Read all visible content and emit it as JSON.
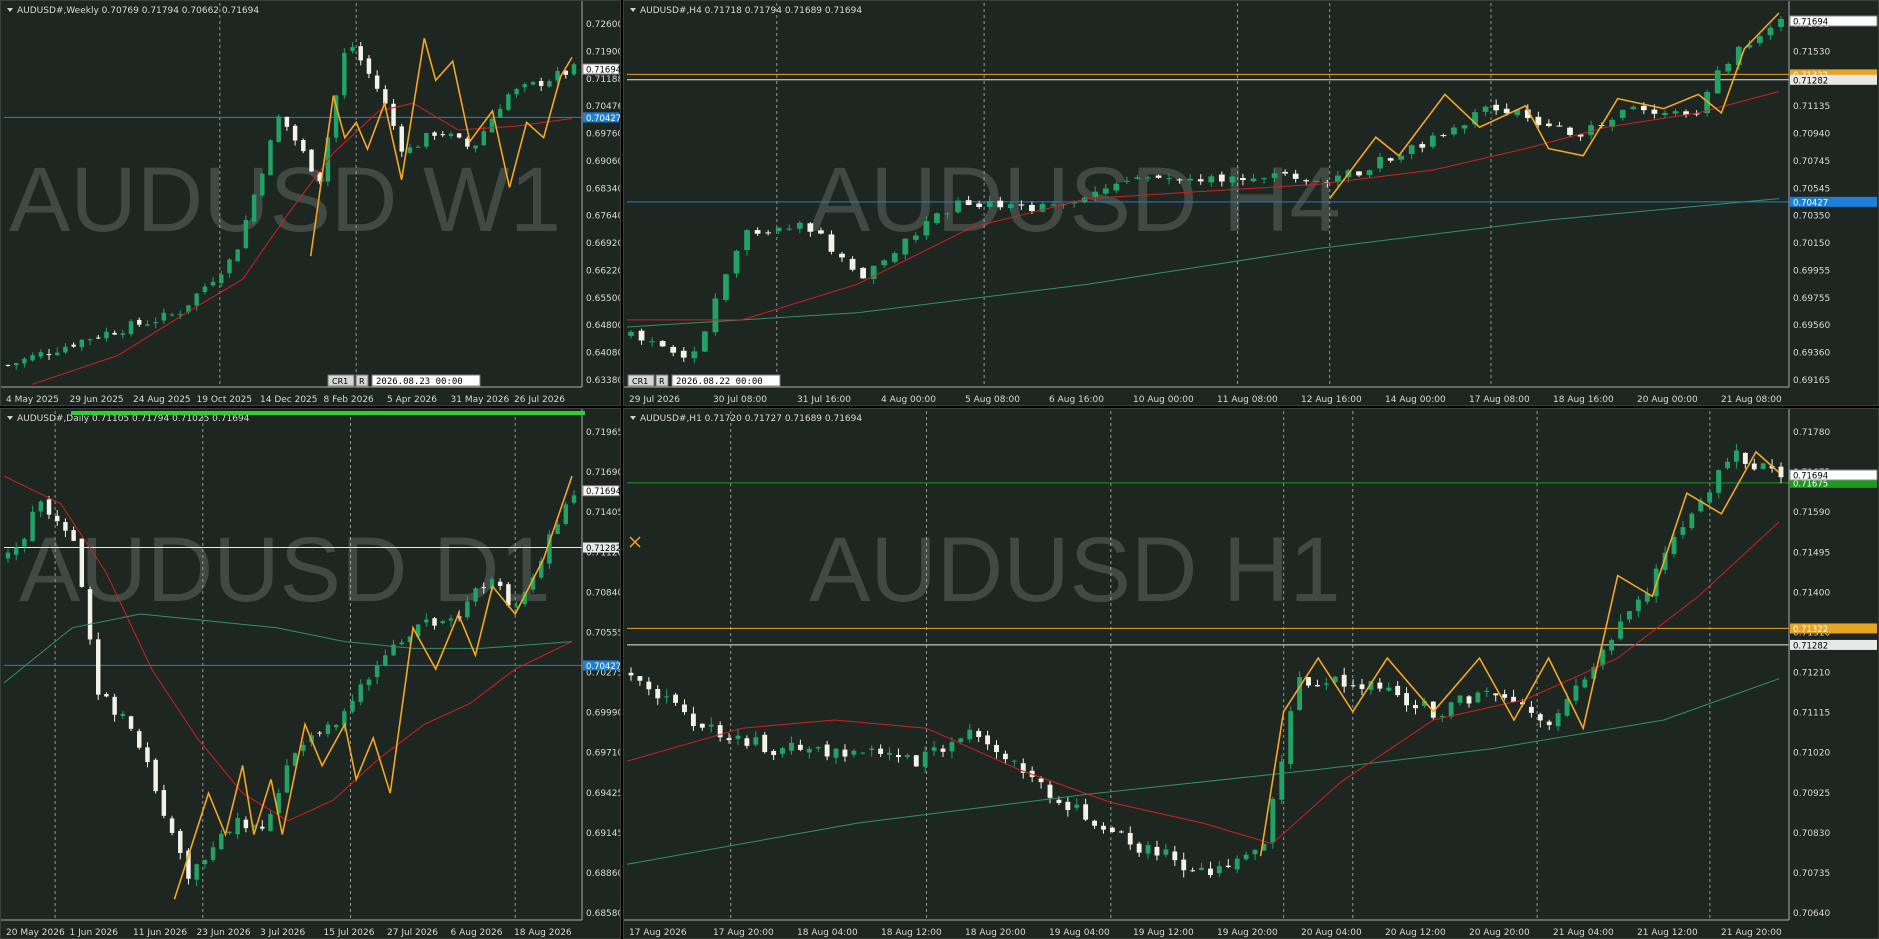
{
  "colors": {
    "bg": "#1e2621",
    "bull": "#21a366",
    "bear": "#f3f3e8",
    "ma_fast": "#d11f1f",
    "ma_slow": "#33906a",
    "zigzag": "#f5a623",
    "hline_blue": "#1c7fd8",
    "hline_white": "#e8e8e8",
    "hline_orange": "#e8a423",
    "hline_green": "#1a9b1a",
    "grid": "#c8c8c8",
    "text": "#d9d9d9"
  },
  "charts": [
    {
      "id": "w1",
      "header": "AUDUSD#,Weekly  0.70769 0.71794 0.70662 0.71694",
      "watermark": "AUDUSD W1",
      "ylim": [
        0.6338,
        0.7316
      ],
      "price_labels": [
        "0.72600",
        "0.71900",
        "0.71188",
        "0.70476",
        "0.69760",
        "0.69060",
        "0.68340",
        "0.67640",
        "0.66920",
        "0.66220",
        "0.65500",
        "0.64800",
        "0.64080",
        "0.63380"
      ],
      "time_labels": [
        "4 May 2025",
        "29 Jun 2025",
        "24 Aug 2025",
        "19 Oct 2025",
        "14 Dec 2025",
        "8 Feb 2026",
        "5 Apr 2026",
        "31 May 2026",
        "26 Jul 2026"
      ],
      "vlines": [
        0.38,
        0.62
      ],
      "hlines": [
        {
          "price": 0.7043,
          "color": "blue",
          "tag": "0.70427"
        }
      ],
      "current_price": "0.71694",
      "cursor": {
        "btn1": "CR1",
        "btn2": "R",
        "time": "2026.08.23 00:00"
      },
      "candles": {
        "count": 70,
        "start": 0.6395,
        "end": 0.7169,
        "path": [
          [
            0,
            0.6395
          ],
          [
            0.15,
            0.647
          ],
          [
            0.3,
            0.653
          ],
          [
            0.4,
            0.668
          ],
          [
            0.48,
            0.705
          ],
          [
            0.55,
            0.688
          ],
          [
            0.6,
            0.725
          ],
          [
            0.66,
            0.71
          ],
          [
            0.7,
            0.695
          ],
          [
            0.76,
            0.701
          ],
          [
            0.82,
            0.696
          ],
          [
            0.88,
            0.71
          ],
          [
            1.0,
            0.7169
          ]
        ]
      },
      "ma_fast": [
        [
          0.05,
          0.6345
        ],
        [
          0.2,
          0.642
        ],
        [
          0.33,
          0.654
        ],
        [
          0.42,
          0.662
        ],
        [
          0.5,
          0.679
        ],
        [
          0.58,
          0.695
        ],
        [
          0.66,
          0.706
        ],
        [
          0.72,
          0.708
        ],
        [
          0.8,
          0.701
        ],
        [
          0.9,
          0.702
        ],
        [
          1.0,
          0.704
        ]
      ],
      "ma_slow": [],
      "zigzag": [
        [
          0.54,
          0.668
        ],
        [
          0.58,
          0.71
        ],
        [
          0.6,
          0.699
        ],
        [
          0.62,
          0.703
        ],
        [
          0.64,
          0.696
        ],
        [
          0.67,
          0.708
        ],
        [
          0.7,
          0.688
        ],
        [
          0.74,
          0.725
        ],
        [
          0.76,
          0.714
        ],
        [
          0.79,
          0.719
        ],
        [
          0.82,
          0.698
        ],
        [
          0.86,
          0.706
        ],
        [
          0.89,
          0.686
        ],
        [
          0.92,
          0.703
        ],
        [
          0.95,
          0.699
        ],
        [
          0.98,
          0.715
        ],
        [
          1.0,
          0.72
        ]
      ]
    },
    {
      "id": "h4",
      "header": "AUDUSD#,H4  0.71718 0.71794 0.71689 0.71694",
      "watermark": "AUDUSD H4",
      "ylim": [
        0.6913,
        0.7175
      ],
      "price_labels": [
        "0.71735",
        "0.71530",
        "0.71330",
        "0.71135",
        "0.70940",
        "0.70745",
        "0.70545",
        "0.70350",
        "0.70150",
        "0.69955",
        "0.69755",
        "0.69560",
        "0.69360",
        "0.69165"
      ],
      "time_labels": [
        "29 Jul 2026",
        "30 Jul 08:00",
        "31 Jul 16:00",
        "4 Aug 00:00",
        "5 Aug 08:00",
        "6 Aug 16:00",
        "10 Aug 00:00",
        "11 Aug 08:00",
        "12 Aug 16:00",
        "14 Aug 00:00",
        "17 Aug 08:00",
        "18 Aug 16:00",
        "20 Aug 00:00",
        "21 Aug 08:00"
      ],
      "vlines": [
        0.13,
        0.31,
        0.53,
        0.61,
        0.75
      ],
      "hlines": [
        {
          "price": 0.7132,
          "color": "orange",
          "tag": "0.71322"
        },
        {
          "price": 0.71282,
          "color": "white",
          "tag": "0.71282"
        },
        {
          "price": 0.70427,
          "color": "blue",
          "tag": "0.70427"
        }
      ],
      "current_price": "0.71694",
      "cursor": {
        "btn1": "CR1",
        "btn2": "R",
        "time": "2026.08.22 00:00"
      },
      "candles": {
        "count": 110,
        "start": 0.695,
        "end": 0.7169,
        "path": [
          [
            0,
            0.695
          ],
          [
            0.05,
            0.693
          ],
          [
            0.1,
            0.702
          ],
          [
            0.15,
            0.703
          ],
          [
            0.2,
            0.699
          ],
          [
            0.28,
            0.704
          ],
          [
            0.36,
            0.704
          ],
          [
            0.45,
            0.706
          ],
          [
            0.55,
            0.706
          ],
          [
            0.62,
            0.706
          ],
          [
            0.68,
            0.708
          ],
          [
            0.75,
            0.711
          ],
          [
            0.82,
            0.709
          ],
          [
            0.88,
            0.711
          ],
          [
            0.92,
            0.71
          ],
          [
            0.96,
            0.715
          ],
          [
            1.0,
            0.7169
          ]
        ]
      },
      "ma_fast": [
        [
          0,
          0.696
        ],
        [
          0.1,
          0.696
        ],
        [
          0.2,
          0.6985
        ],
        [
          0.3,
          0.7025
        ],
        [
          0.4,
          0.7045
        ],
        [
          0.5,
          0.705
        ],
        [
          0.6,
          0.7055
        ],
        [
          0.7,
          0.7065
        ],
        [
          0.78,
          0.708
        ],
        [
          0.85,
          0.7095
        ],
        [
          0.93,
          0.7105
        ],
        [
          1.0,
          0.712
        ]
      ],
      "ma_slow": [
        [
          0,
          0.6955
        ],
        [
          0.2,
          0.6965
        ],
        [
          0.4,
          0.6985
        ],
        [
          0.6,
          0.701
        ],
        [
          0.8,
          0.703
        ],
        [
          1.0,
          0.7045
        ]
      ],
      "zigzag": [
        [
          0.61,
          0.7045
        ],
        [
          0.65,
          0.7088
        ],
        [
          0.67,
          0.7075
        ],
        [
          0.71,
          0.7118
        ],
        [
          0.74,
          0.7095
        ],
        [
          0.78,
          0.711
        ],
        [
          0.8,
          0.708
        ],
        [
          0.83,
          0.7075
        ],
        [
          0.86,
          0.7115
        ],
        [
          0.9,
          0.7108
        ],
        [
          0.93,
          0.7118
        ],
        [
          0.95,
          0.7105
        ],
        [
          0.97,
          0.715
        ],
        [
          1.0,
          0.7175
        ]
      ]
    },
    {
      "id": "d1",
      "header": "AUDUSD#,Daily  0.71105 0.71794 0.71025 0.71694",
      "watermark": "AUDUSD D1",
      "ylim": [
        0.6858,
        0.722
      ],
      "price_labels": [
        "0.71965",
        "0.71690",
        "0.71405",
        "0.71120",
        "0.70840",
        "0.70555",
        "0.70275",
        "0.69990",
        "0.69710",
        "0.69425",
        "0.69145",
        "0.68860",
        "0.68580"
      ],
      "time_labels": [
        "20 May 2026",
        "1 Jun 2026",
        "11 Jun 2026",
        "23 Jun 2026",
        "3 Jul 2026",
        "15 Jul 2026",
        "27 Jul 2026",
        "6 Aug 2026",
        "18 Aug 2026"
      ],
      "vlines": [
        0.09,
        0.35,
        0.61,
        0.9
      ],
      "hlines": [
        {
          "price": 0.71282,
          "color": "white",
          "tag": "0.71282"
        },
        {
          "price": 0.70427,
          "color": "blue",
          "tag": "0.70427"
        }
      ],
      "current_price": "0.71694",
      "candles": {
        "count": 70,
        "start": 0.712,
        "end": 0.7169,
        "path": [
          [
            0,
            0.712
          ],
          [
            0.06,
            0.716
          ],
          [
            0.12,
            0.713
          ],
          [
            0.16,
            0.702
          ],
          [
            0.22,
            0.7
          ],
          [
            0.28,
            0.693
          ],
          [
            0.32,
            0.689
          ],
          [
            0.4,
            0.693
          ],
          [
            0.45,
            0.692
          ],
          [
            0.5,
            0.698
          ],
          [
            0.55,
            0.699
          ],
          [
            0.6,
            0.701
          ],
          [
            0.65,
            0.704
          ],
          [
            0.72,
            0.707
          ],
          [
            0.8,
            0.708
          ],
          [
            0.85,
            0.711
          ],
          [
            0.9,
            0.708
          ],
          [
            0.95,
            0.713
          ],
          [
            1.0,
            0.7169
          ]
        ]
      },
      "ma_fast": [
        [
          0,
          0.718
        ],
        [
          0.1,
          0.716
        ],
        [
          0.18,
          0.711
        ],
        [
          0.26,
          0.704
        ],
        [
          0.34,
          0.699
        ],
        [
          0.42,
          0.695
        ],
        [
          0.5,
          0.693
        ],
        [
          0.58,
          0.6945
        ],
        [
          0.66,
          0.6975
        ],
        [
          0.74,
          0.7
        ],
        [
          0.82,
          0.7015
        ],
        [
          0.9,
          0.704
        ],
        [
          1.0,
          0.706
        ]
      ],
      "ma_slow": [
        [
          0,
          0.703
        ],
        [
          0.12,
          0.707
        ],
        [
          0.24,
          0.708
        ],
        [
          0.36,
          0.7075
        ],
        [
          0.48,
          0.707
        ],
        [
          0.6,
          0.706
        ],
        [
          0.72,
          0.7055
        ],
        [
          0.84,
          0.7055
        ],
        [
          1.0,
          0.706
        ]
      ],
      "zigzag": [
        [
          0.3,
          0.6873
        ],
        [
          0.36,
          0.695
        ],
        [
          0.39,
          0.692
        ],
        [
          0.42,
          0.697
        ],
        [
          0.44,
          0.692
        ],
        [
          0.47,
          0.696
        ],
        [
          0.49,
          0.692
        ],
        [
          0.53,
          0.7
        ],
        [
          0.56,
          0.697
        ],
        [
          0.6,
          0.7
        ],
        [
          0.62,
          0.696
        ],
        [
          0.65,
          0.699
        ],
        [
          0.68,
          0.695
        ],
        [
          0.72,
          0.707
        ],
        [
          0.76,
          0.704
        ],
        [
          0.8,
          0.708
        ],
        [
          0.83,
          0.705
        ],
        [
          0.86,
          0.71
        ],
        [
          0.9,
          0.708
        ],
        [
          0.95,
          0.712
        ],
        [
          1.0,
          0.718
        ]
      ]
    },
    {
      "id": "h1",
      "header": "AUDUSD#,H1  0.71720 0.71727 0.71689 0.71694",
      "watermark": "AUDUSD H1",
      "ylim": [
        0.70615,
        0.71825
      ],
      "price_labels": [
        "0.71780",
        "0.71675",
        "0.71590",
        "0.71495",
        "0.71400",
        "0.71310",
        "0.71210",
        "0.71115",
        "0.71020",
        "0.70925",
        "0.70830",
        "0.70735",
        "0.70640"
      ],
      "time_labels": [
        "17 Aug 2026",
        "17 Aug 20:00",
        "18 Aug 04:00",
        "18 Aug 12:00",
        "18 Aug 20:00",
        "19 Aug 04:00",
        "19 Aug 12:00",
        "19 Aug 20:00",
        "20 Aug 04:00",
        "20 Aug 12:00",
        "20 Aug 20:00",
        "21 Aug 04:00",
        "21 Aug 12:00",
        "21 Aug 20:00"
      ],
      "vlines": [
        0.09,
        0.26,
        0.42,
        0.57,
        0.63,
        0.79,
        0.94
      ],
      "hlines": [
        {
          "price": 0.71675,
          "color": "green",
          "tag": "0.71675"
        },
        {
          "price": 0.71322,
          "color": "orange",
          "tag": "0.71322"
        },
        {
          "price": 0.71282,
          "color": "white",
          "tag": "0.71282"
        }
      ],
      "current_price": "0.71694",
      "candles": {
        "count": 130,
        "start": 0.7122,
        "end": 0.7169,
        "path": [
          [
            0,
            0.7122
          ],
          [
            0.05,
            0.711
          ],
          [
            0.12,
            0.7103
          ],
          [
            0.2,
            0.7102
          ],
          [
            0.25,
            0.71
          ],
          [
            0.3,
            0.7108
          ],
          [
            0.35,
            0.7095
          ],
          [
            0.42,
            0.7082
          ],
          [
            0.5,
            0.7073
          ],
          [
            0.55,
            0.708
          ],
          [
            0.58,
            0.712
          ],
          [
            0.65,
            0.7118
          ],
          [
            0.7,
            0.7112
          ],
          [
            0.75,
            0.7118
          ],
          [
            0.8,
            0.711
          ],
          [
            0.84,
            0.7125
          ],
          [
            0.88,
            0.714
          ],
          [
            0.92,
            0.716
          ],
          [
            0.96,
            0.7175
          ],
          [
            1.0,
            0.7169
          ]
        ]
      },
      "ma_fast": [
        [
          0,
          0.71
        ],
        [
          0.1,
          0.7108
        ],
        [
          0.18,
          0.711
        ],
        [
          0.26,
          0.7108
        ],
        [
          0.34,
          0.7098
        ],
        [
          0.42,
          0.709
        ],
        [
          0.5,
          0.7085
        ],
        [
          0.56,
          0.708
        ],
        [
          0.62,
          0.7095
        ],
        [
          0.7,
          0.711
        ],
        [
          0.78,
          0.7115
        ],
        [
          0.86,
          0.7125
        ],
        [
          0.93,
          0.714
        ],
        [
          1.0,
          0.7158
        ]
      ],
      "ma_slow": [
        [
          0,
          0.7075
        ],
        [
          0.2,
          0.7085
        ],
        [
          0.4,
          0.7092
        ],
        [
          0.6,
          0.7098
        ],
        [
          0.75,
          0.7103
        ],
        [
          0.9,
          0.711
        ],
        [
          1.0,
          0.712
        ]
      ],
      "zigzag": [
        [
          0.55,
          0.7077
        ],
        [
          0.57,
          0.7112
        ],
        [
          0.6,
          0.7125
        ],
        [
          0.63,
          0.7112
        ],
        [
          0.66,
          0.7125
        ],
        [
          0.7,
          0.7112
        ],
        [
          0.74,
          0.7125
        ],
        [
          0.77,
          0.711
        ],
        [
          0.8,
          0.7125
        ],
        [
          0.83,
          0.7108
        ],
        [
          0.86,
          0.7145
        ],
        [
          0.89,
          0.714
        ],
        [
          0.92,
          0.7165
        ],
        [
          0.95,
          0.716
        ],
        [
          0.98,
          0.7175
        ],
        [
          1.0,
          0.717
        ]
      ]
    }
  ]
}
